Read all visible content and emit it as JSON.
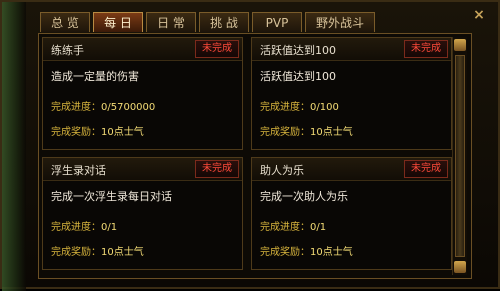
{
  "window": {
    "close_label": "×"
  },
  "tabs": [
    {
      "label": "总 览",
      "active": false
    },
    {
      "label": "每 日",
      "active": true
    },
    {
      "label": "日 常",
      "active": false
    },
    {
      "label": "挑 战",
      "active": false
    },
    {
      "label": "PVP",
      "active": false
    },
    {
      "label": "野外战斗",
      "active": false
    }
  ],
  "tasks": [
    {
      "title": "练练手",
      "status": "未完成",
      "description": "造成一定量的伤害",
      "progress_label": "完成进度：",
      "progress_value": "0/5700000",
      "reward_label": "完成奖励：",
      "reward_value": "10点士气"
    },
    {
      "title": "活跃值达到100",
      "status": "未完成",
      "description": "活跃值达到100",
      "progress_label": "完成进度：",
      "progress_value": "0/100",
      "reward_label": "完成奖励：",
      "reward_value": "10点士气"
    },
    {
      "title": "浮生录对话",
      "status": "未完成",
      "description": "完成一次浮生录每日对话",
      "progress_label": "完成进度：",
      "progress_value": "0/1",
      "reward_label": "完成奖励：",
      "reward_value": "10点士气"
    },
    {
      "title": "助人为乐",
      "status": "未完成",
      "description": "完成一次助人为乐",
      "progress_label": "完成进度：",
      "progress_value": "0/1",
      "reward_label": "完成奖励：",
      "reward_value": "10点士气"
    }
  ],
  "icons": {
    "close": "close-icon",
    "scroll_up": "scroll-up-icon",
    "scroll_down": "scroll-down-icon"
  }
}
